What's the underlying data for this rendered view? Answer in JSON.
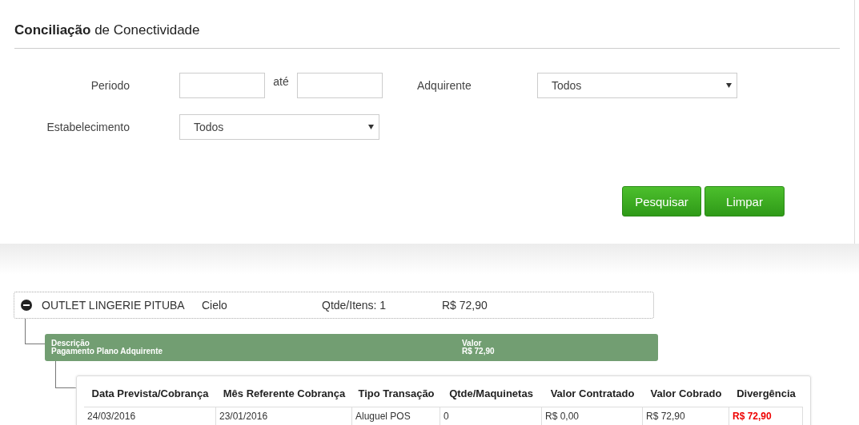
{
  "title": "**Conciliação** de Conectividade",
  "filters": {
    "period_label": "Periodo",
    "between_label": "até",
    "acquirer_label": "Adquirente",
    "acquirer": {
      "value": "Todos"
    },
    "establishment_label": "Estabelecimento",
    "establishment": {
      "value": "Todos"
    }
  },
  "buttons": [
    "Pesquisar",
    "Limpar"
  ],
  "group": {
    "expanded": true,
    "name": "OUTLET LINGERIE PITUBA",
    "acquirer": "Cielo",
    "count": "Qtde/Itens: 1",
    "total": "R$ 72,90",
    "summary": {
      "description_label": "Descrição",
      "description": "Pagamento Plano Adquirente",
      "value_label": "Valor",
      "value": "R$ 72,90"
    },
    "table": {
      "columns": [
        "Data Prevista/Cobrança",
        "Mês Referente Cobrança",
        "Tipo Transação",
        "Qtde/Maquinetas",
        "Valor Contratado",
        "Valor Cobrado",
        "Divergência"
      ],
      "rows": [
        {
          "cells": [
            "24/03/2016",
            "23/01/2016",
            "Aluguel POS",
            "0",
            "R$ 0,00",
            "R$ 72,90",
            "R$ 72,90"
          ],
          "divergent": true
        }
      ]
    }
  }
}
